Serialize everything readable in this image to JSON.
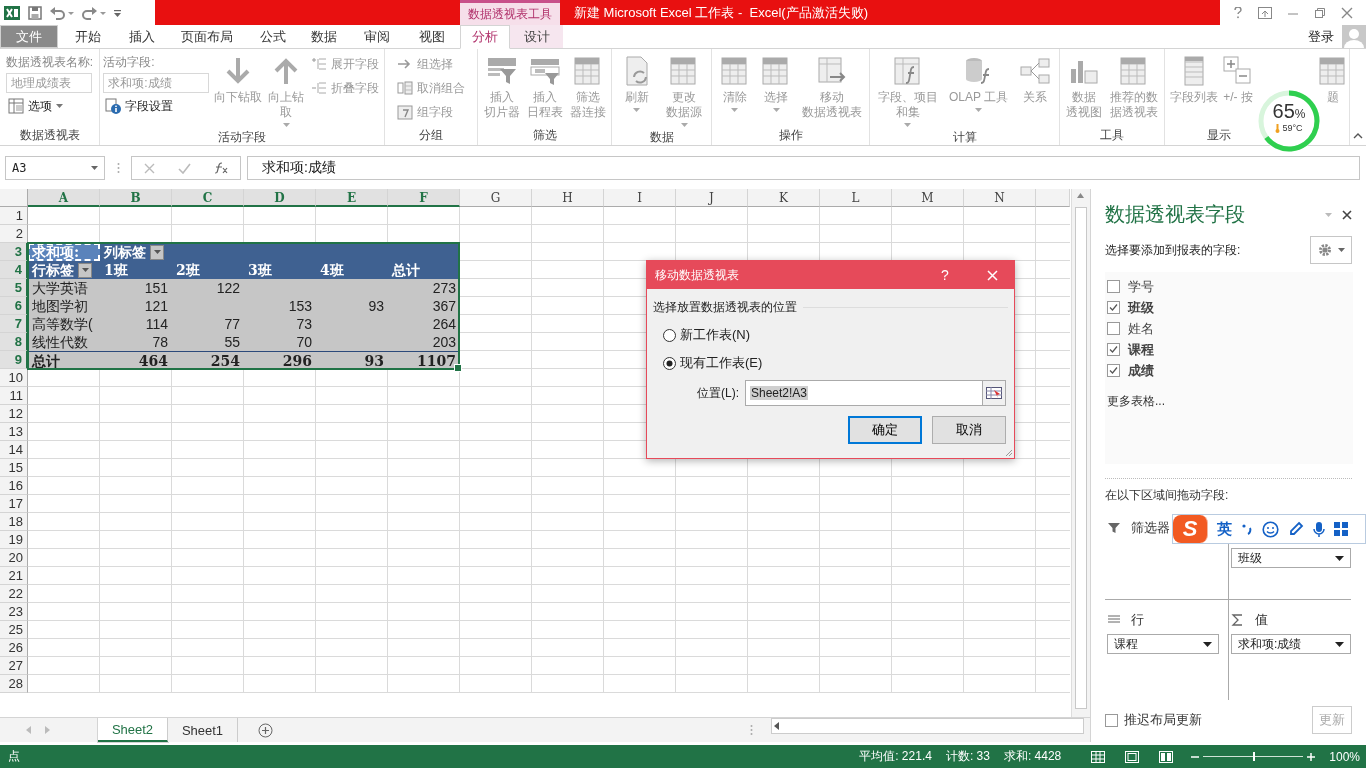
{
  "window": {
    "context_tab": "数据透视表工具",
    "title": "新建 Microsoft Excel 工作表 -  Excel(产品激活失败)"
  },
  "account": {
    "label": "登录"
  },
  "tabs": [
    {
      "label": "文件",
      "selected": false,
      "kind": "file"
    },
    {
      "label": "开始",
      "selected": false,
      "kind": "normal"
    },
    {
      "label": "插入",
      "selected": false,
      "kind": "normal"
    },
    {
      "label": "页面布局",
      "selected": false,
      "kind": "normal"
    },
    {
      "label": "公式",
      "selected": false,
      "kind": "normal"
    },
    {
      "label": "数据",
      "selected": false,
      "kind": "normal"
    },
    {
      "label": "审阅",
      "selected": false,
      "kind": "normal"
    },
    {
      "label": "视图",
      "selected": false,
      "kind": "normal"
    },
    {
      "label": "分析",
      "selected": true,
      "kind": "context"
    },
    {
      "label": "设计",
      "selected": false,
      "kind": "context"
    }
  ],
  "ribbon": {
    "groups": [
      {
        "label": "数据透视表",
        "columns": [
          [
            {
              "kind": "label",
              "label": "数据透视表名称:"
            },
            {
              "kind": "input",
              "value": "地理成绩表",
              "disabled": true
            },
            {
              "kind": "small",
              "label": "选项",
              "dropdown": true,
              "disabled": false
            }
          ]
        ]
      },
      {
        "label": "活动字段",
        "columns": [
          [
            {
              "kind": "label",
              "label": "活动字段:"
            },
            {
              "kind": "input",
              "value": "求和项:成绩",
              "disabled": true
            },
            {
              "kind": "small",
              "label": "字段设置",
              "dropdown": false,
              "disabled": false
            }
          ],
          [
            {
              "kind": "large",
              "label": "向下钻取",
              "dropdown": false,
              "disabled": true
            }
          ],
          [
            {
              "kind": "large",
              "label": "向上钻取",
              "dropdown": true,
              "disabled": true
            }
          ],
          [
            {
              "kind": "small",
              "label": "展开字段",
              "dropdown": false,
              "disabled": true
            },
            {
              "kind": "small",
              "label": "折叠字段",
              "dropdown": false,
              "disabled": true
            }
          ]
        ]
      },
      {
        "label": "分组",
        "columns": [
          [
            {
              "kind": "small",
              "label": "组选择",
              "dropdown": false,
              "disabled": true
            },
            {
              "kind": "small",
              "label": "取消组合",
              "dropdown": false,
              "disabled": true
            },
            {
              "kind": "small",
              "label": "组字段",
              "dropdown": false,
              "disabled": true
            }
          ]
        ]
      },
      {
        "label": "筛选",
        "columns": [
          [
            {
              "kind": "large",
              "label": "插入切片器",
              "dropdown": false,
              "disabled": true
            }
          ],
          [
            {
              "kind": "large",
              "label": "插入日程表",
              "dropdown": false,
              "disabled": true
            }
          ],
          [
            {
              "kind": "large",
              "label": "筛选器连接",
              "dropdown": false,
              "disabled": true
            }
          ]
        ]
      },
      {
        "label": "数据",
        "columns": [
          [
            {
              "kind": "large",
              "label": "刷新",
              "dropdown": true,
              "disabled": true
            }
          ],
          [
            {
              "kind": "large",
              "label": "更改数据源",
              "dropdown": true,
              "disabled": true
            }
          ]
        ]
      },
      {
        "label": "操作",
        "columns": [
          [
            {
              "kind": "large",
              "label": "清除",
              "dropdown": true,
              "disabled": true
            }
          ],
          [
            {
              "kind": "large",
              "label": "选择",
              "dropdown": true,
              "disabled": true
            }
          ],
          [
            {
              "kind": "large",
              "label": "移动数据透视表",
              "dropdown": false,
              "disabled": true
            }
          ]
        ]
      },
      {
        "label": "计算",
        "columns": [
          [
            {
              "kind": "large",
              "label": "字段、项目和集",
              "dropdown": true,
              "disabled": true
            }
          ],
          [
            {
              "kind": "large",
              "label": "OLAP 工具",
              "dropdown": true,
              "disabled": true
            }
          ],
          [
            {
              "kind": "large",
              "label": "关系",
              "dropdown": false,
              "disabled": true
            }
          ]
        ]
      },
      {
        "label": "工具",
        "columns": [
          [
            {
              "kind": "large",
              "label": "数据透视图",
              "dropdown": false,
              "disabled": true
            }
          ],
          [
            {
              "kind": "large",
              "label": "推荐的数据透视表",
              "dropdown": false,
              "disabled": true
            }
          ]
        ]
      },
      {
        "label": "显示",
        "columns": [
          [
            {
              "kind": "large",
              "label": "字段列表",
              "dropdown": false,
              "disabled": true
            }
          ],
          [
            {
              "kind": "large",
              "label": "+/- 按",
              "dropdown": false,
              "disabled": true
            }
          ],
          [
            {
              "kind": "large",
              "label": "题",
              "dropdown": false,
              "disabled": true
            }
          ]
        ]
      }
    ]
  },
  "gauge": {
    "percent": "65",
    "unit": "%",
    "temperature": "59°C"
  },
  "formula_bar": {
    "name_box": "A3",
    "formula": "求和项:成绩"
  },
  "sheet": {
    "columns": [
      {
        "label": "A",
        "selected": true
      },
      {
        "label": "B",
        "selected": true
      },
      {
        "label": "C",
        "selected": true
      },
      {
        "label": "D",
        "selected": true
      },
      {
        "label": "E",
        "selected": true
      },
      {
        "label": "F",
        "selected": true
      },
      {
        "label": "G",
        "selected": false
      },
      {
        "label": "H",
        "selected": false
      },
      {
        "label": "I",
        "selected": false
      },
      {
        "label": "J",
        "selected": false
      },
      {
        "label": "K",
        "selected": false
      },
      {
        "label": "L",
        "selected": false
      },
      {
        "label": "M",
        "selected": false
      },
      {
        "label": "N",
        "selected": false
      }
    ],
    "rows": [
      {
        "label": "1",
        "selected": false
      },
      {
        "label": "2",
        "selected": false
      },
      {
        "label": "3",
        "selected": true
      },
      {
        "label": "4",
        "selected": true
      },
      {
        "label": "5",
        "selected": true
      },
      {
        "label": "6",
        "selected": true
      },
      {
        "label": "7",
        "selected": true
      },
      {
        "label": "8",
        "selected": true
      },
      {
        "label": "9",
        "selected": true
      },
      {
        "label": "10",
        "selected": false
      },
      {
        "label": "11",
        "selected": false
      },
      {
        "label": "12",
        "selected": false
      },
      {
        "label": "13",
        "selected": false
      },
      {
        "label": "14",
        "selected": false
      },
      {
        "label": "15",
        "selected": false
      },
      {
        "label": "16",
        "selected": false
      },
      {
        "label": "17",
        "selected": false
      },
      {
        "label": "18",
        "selected": false
      },
      {
        "label": "19",
        "selected": false
      },
      {
        "label": "20",
        "selected": false
      },
      {
        "label": "21",
        "selected": false
      },
      {
        "label": "22",
        "selected": false
      },
      {
        "label": "23",
        "selected": false
      },
      {
        "label": "25",
        "selected": false
      },
      {
        "label": "26",
        "selected": false
      },
      {
        "label": "27",
        "selected": false
      },
      {
        "label": "28",
        "selected": false
      }
    ],
    "pivot": {
      "value_field": "求和项:",
      "column_label": "列标签",
      "row_label": "行标签",
      "column_headers": [
        "1班",
        "2班",
        "3班",
        "4班",
        "总计"
      ],
      "rows": [
        {
          "label": "大学英语",
          "cells": [
            {
              "kind": "number",
              "value": "151"
            },
            {
              "kind": "number",
              "value": "122"
            },
            {
              "kind": "blank"
            },
            {
              "kind": "blank"
            },
            {
              "kind": "number",
              "value": "273"
            }
          ]
        },
        {
          "label": "地图学初",
          "cells": [
            {
              "kind": "number",
              "value": "121"
            },
            {
              "kind": "blank"
            },
            {
              "kind": "number",
              "value": "153"
            },
            {
              "kind": "number",
              "value": "93"
            },
            {
              "kind": "number",
              "value": "367"
            }
          ]
        },
        {
          "label": "高等数学(",
          "cells": [
            {
              "kind": "number",
              "value": "114"
            },
            {
              "kind": "number",
              "value": "77"
            },
            {
              "kind": "number",
              "value": "73"
            },
            {
              "kind": "blank"
            },
            {
              "kind": "number",
              "value": "264"
            }
          ]
        },
        {
          "label": "线性代数",
          "cells": [
            {
              "kind": "number",
              "value": "78"
            },
            {
              "kind": "number",
              "value": "55"
            },
            {
              "kind": "number",
              "value": "70"
            },
            {
              "kind": "blank"
            },
            {
              "kind": "number",
              "value": "203"
            }
          ]
        }
      ],
      "total": {
        "label": "总计",
        "values": [
          "464",
          "254",
          "296",
          "93",
          "1107"
        ]
      }
    }
  },
  "sheet_tabs": [
    {
      "label": "Sheet2",
      "selected": true
    },
    {
      "label": "Sheet1",
      "selected": false
    }
  ],
  "dialog": {
    "title": "移动数据透视表",
    "help": "?",
    "section": "选择放置数据透视表的位置",
    "options": [
      {
        "label": "新工作表(N)",
        "selected": false
      },
      {
        "label": "现有工作表(E)",
        "selected": true
      }
    ],
    "location_label": "位置(L):",
    "location_value": "Sheet2!A3",
    "buttons": [
      {
        "label": "确定",
        "default": true
      },
      {
        "label": "取消",
        "default": false
      }
    ]
  },
  "field_panel": {
    "title": "数据透视表字段",
    "subtitle": "选择要添加到报表的字段:",
    "fields": [
      {
        "label": "学号",
        "checked": false
      },
      {
        "label": "班级",
        "checked": true
      },
      {
        "label": "姓名",
        "checked": false
      },
      {
        "label": "课程",
        "checked": true
      },
      {
        "label": "成绩",
        "checked": true
      }
    ],
    "more_tables": "更多表格...",
    "areas_caption": "在以下区域间拖动字段:",
    "areas": [
      {
        "kind": "filter",
        "label": "筛选器"
      },
      {
        "kind": "columns",
        "items": [
          "班级"
        ]
      },
      {
        "kind": "rows",
        "label": "行",
        "items": [
          "课程"
        ]
      },
      {
        "kind": "values",
        "label": "值",
        "items": [
          "求和项:成绩"
        ]
      }
    ],
    "defer_update": {
      "label": "推迟布局更新",
      "checked": false
    },
    "update_button": {
      "label": "更新",
      "disabled": true
    }
  },
  "ime_bar": {
    "logo": "S",
    "mode": "英"
  },
  "status_bar": {
    "mode": "点",
    "average": "平均值: 221.4",
    "count": "计数: 33",
    "sum": "求和: 4428",
    "zoom": "100%",
    "zoom_slider": {
      "level": 0.5
    }
  }
}
